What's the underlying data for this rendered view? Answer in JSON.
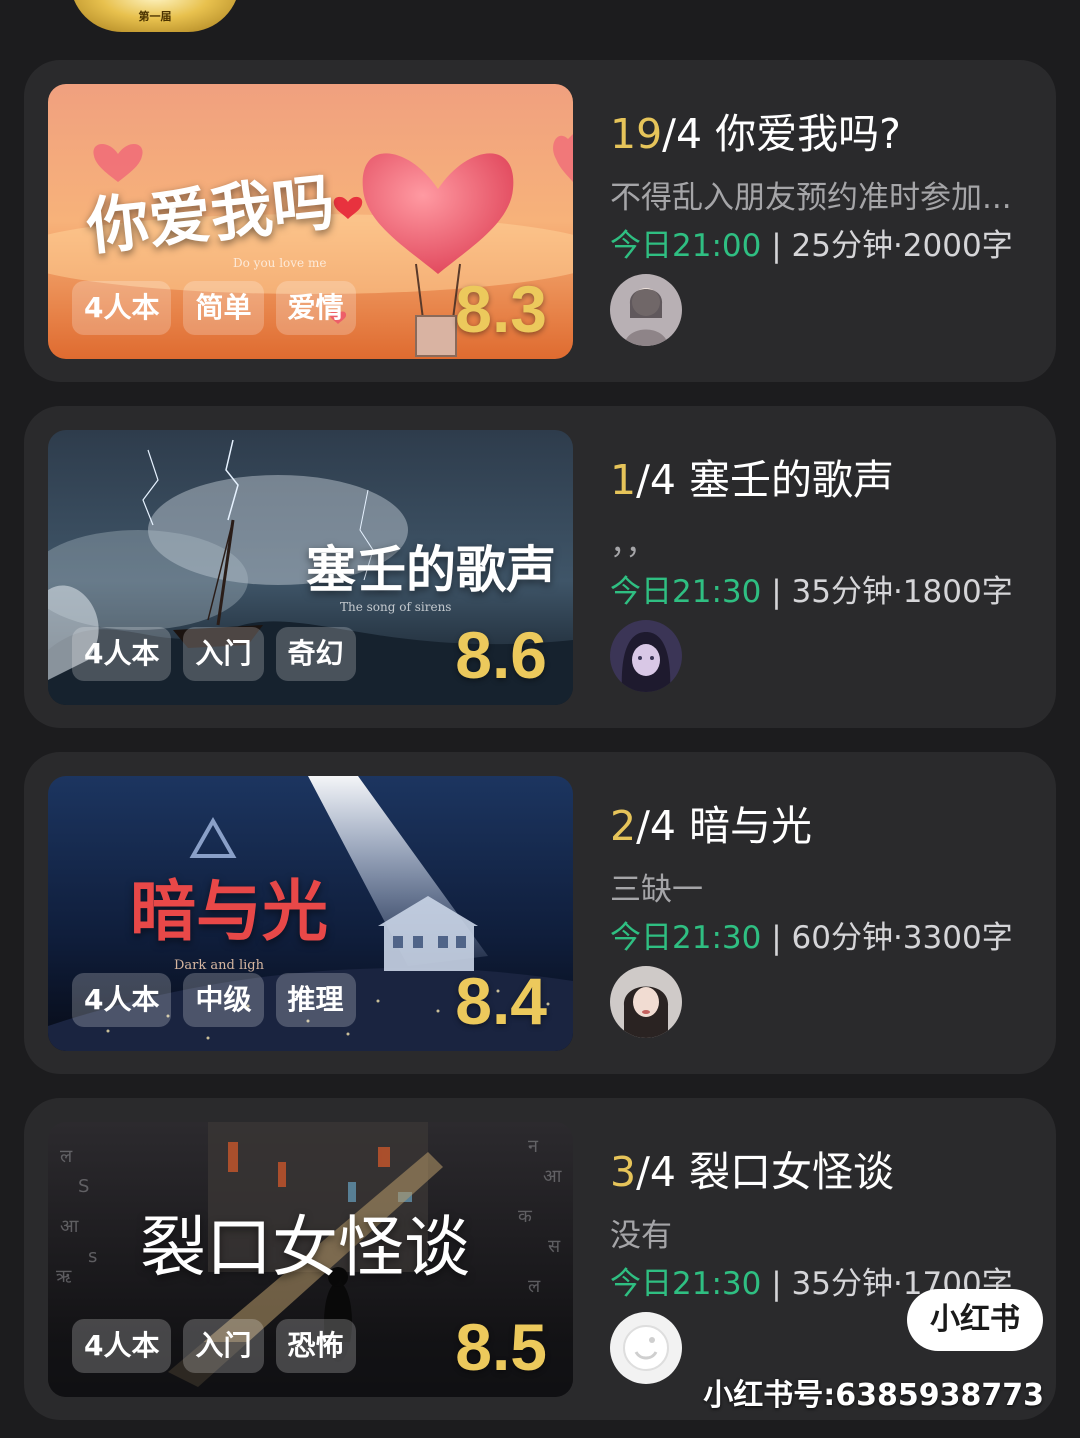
{
  "top_badge": {
    "text": "第一届"
  },
  "cards": [
    {
      "cover_title": "你爱我吗",
      "cover_subtitle": "Do you love me",
      "tags": [
        "4人本",
        "简单",
        "爱情"
      ],
      "score": "8.3",
      "count": "19",
      "total": "/4",
      "name": "你爱我吗?",
      "desc": "不得乱入朋友预约准时参加...",
      "time": "今日21:00",
      "sep": " | ",
      "meta_rest": "25分钟·2000字",
      "colors": {
        "cover_top": "#f2a483",
        "cover_bottom": "#e06a2a"
      }
    },
    {
      "cover_title": "塞壬的歌声",
      "cover_subtitle": "The song of sirens",
      "tags": [
        "4人本",
        "入门",
        "奇幻"
      ],
      "score": "8.6",
      "count": "1",
      "total": "/4",
      "name": "塞壬的歌声",
      "desc": "，，",
      "time": "今日21:30",
      "sep": " | ",
      "meta_rest": "35分钟·1800字",
      "colors": {
        "cover_top": "#3a4a5c",
        "cover_bottom": "#0f1a24"
      }
    },
    {
      "cover_title": "暗与光",
      "cover_subtitle": "Dark and ligh",
      "tags": [
        "4人本",
        "中级",
        "推理"
      ],
      "score": "8.4",
      "count": "2",
      "total": "/4",
      "name": "暗与光",
      "desc": "三缺一",
      "time": "今日21:30",
      "sep": " | ",
      "meta_rest": "60分钟·3300字",
      "colors": {
        "cover_top": "#1e3760",
        "cover_bottom": "#0a1224"
      }
    },
    {
      "cover_title": "裂口女怪谈",
      "cover_subtitle": "",
      "tags": [
        "4人本",
        "入门",
        "恐怖"
      ],
      "score": "8.5",
      "count": "3",
      "total": "/4",
      "name": "裂口女怪谈",
      "desc": "没有",
      "time": "今日21:30",
      "sep": " | ",
      "meta_rest": "35分钟·1700字",
      "colors": {
        "cover_top": "#2a2a2e",
        "cover_bottom": "#0e0e10"
      }
    }
  ],
  "watermark": {
    "logo": "小红书",
    "id": "小红书号:6385938773"
  }
}
